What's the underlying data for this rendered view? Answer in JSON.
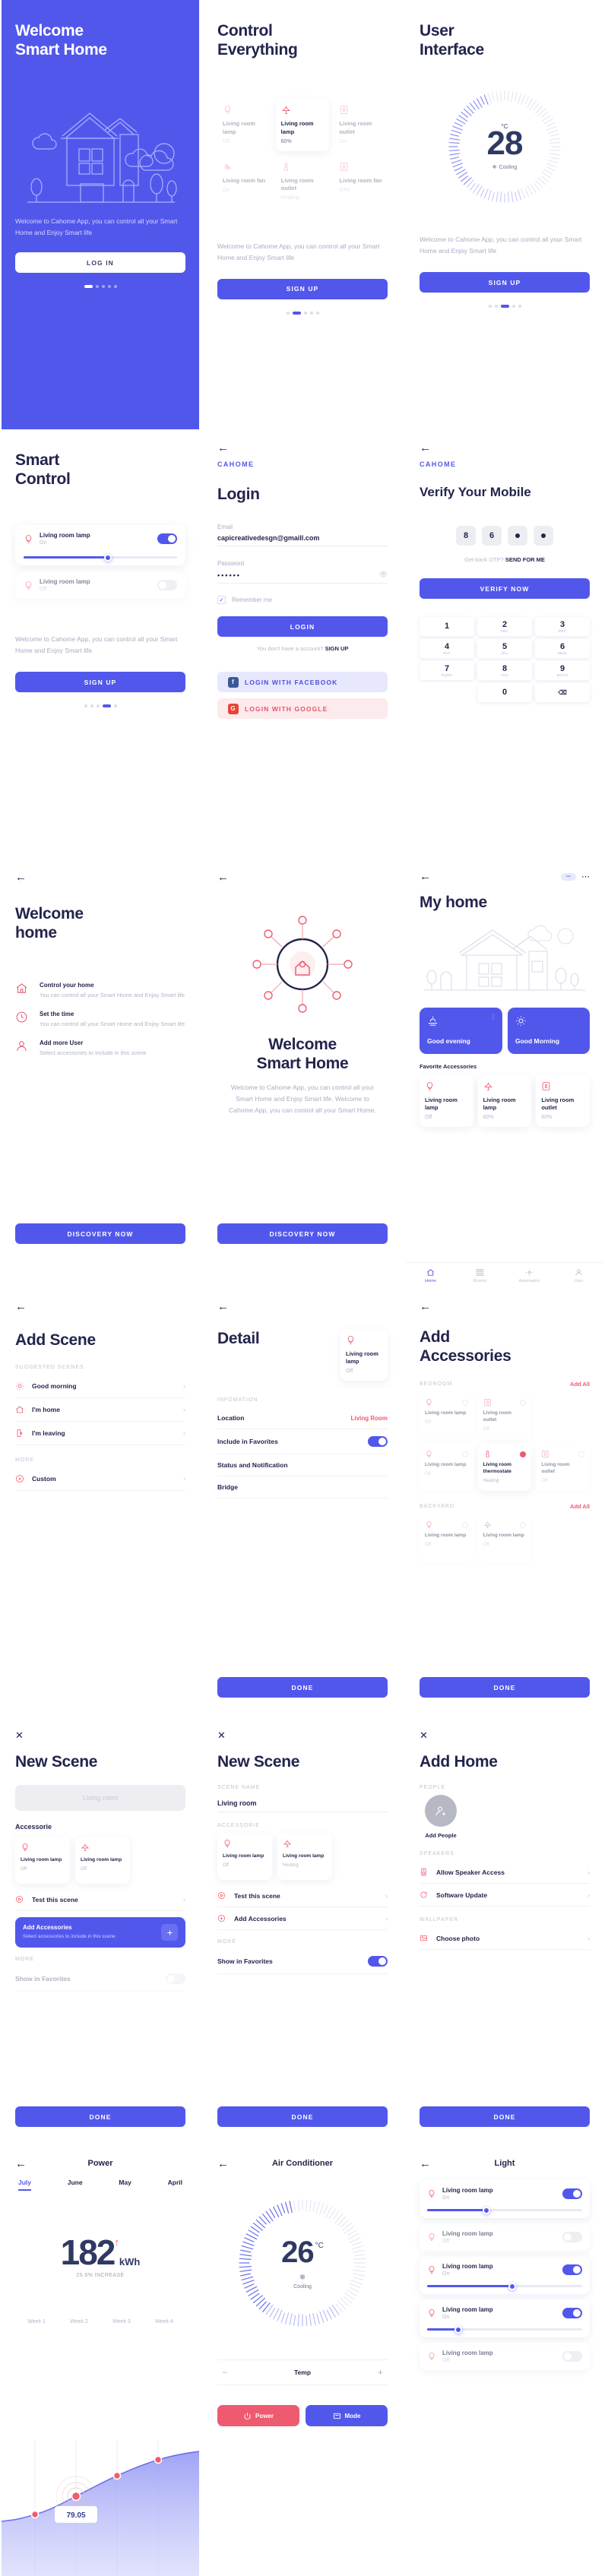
{
  "brand": "CAHOME",
  "tagline": "Welcome to Cahome App, you can control all your Smart Home and Enjoy Smart life",
  "colors": {
    "primary": "#5257ec",
    "accent": "#ee5b70",
    "dark": "#23244d",
    "muted": "#b1b3c7"
  },
  "screens": {
    "welcome": {
      "title_line1": "Welcome",
      "title_line2": "Smart Home",
      "caption": "Welcome to Cahome App, you can control all your Smart Home and Enjoy Smart life",
      "cta": "LOG IN",
      "dots": 5,
      "active": 0
    },
    "control": {
      "title_line1": "Control",
      "title_line2": "Everything",
      "caption": "Welcome to Cahome App, you can control all your Smart Home and Enjoy Smart life",
      "cta": "SIGN UP",
      "dots": 5,
      "active": 1,
      "devices": [
        {
          "icon": "bulb-icon",
          "name": "Living room lamp",
          "status": "Off",
          "state": "dim"
        },
        {
          "icon": "lamp-icon",
          "name": "Living room lamp",
          "status": "60%",
          "state": "active"
        },
        {
          "icon": "outlet-icon",
          "name": "Living room outlet",
          "status": "On",
          "state": "dim"
        },
        {
          "icon": "fan-icon",
          "name": "Living room fan",
          "status": "On",
          "state": "dim"
        },
        {
          "icon": "thermostat-icon",
          "name": "Living room outlet",
          "status": "Heating",
          "state": "dim"
        },
        {
          "icon": "outlet-icon",
          "name": "Living room fan",
          "status": "60%",
          "state": "dim"
        }
      ]
    },
    "user_interface": {
      "title_line1": "User",
      "title_line2": "Interface",
      "caption": "Welcome to Cahome App, you can control all your Smart Home and Enjoy Smart life",
      "cta": "SIGN UP",
      "dots": 5,
      "active": 2,
      "unit": "°C",
      "value": "28",
      "mode": "Cooling"
    },
    "smart_control": {
      "title_line1": "Smart",
      "title_line2": "Control",
      "caption": "Welcome to Cahome App, you can control all your Smart Home and Enjoy Smart life",
      "cta": "SIGN UP",
      "dots": 5,
      "active": 3,
      "items": [
        {
          "name": "Living room lamp",
          "status": "On",
          "toggle": "on",
          "slider": 55
        },
        {
          "name": "Living room lamp",
          "status": "Off",
          "toggle": "off",
          "slider": 0
        }
      ]
    },
    "login": {
      "brand": "CAHOME",
      "title": "Login",
      "email_label": "Email",
      "email_value": "capicreativedesgn@gmaill.com",
      "password_label": "Password",
      "password_value": "••••••",
      "remember": "Remember me",
      "cta": "LOGIN",
      "signup_prompt": "You don't have a account?",
      "signup_link": "SIGN UP",
      "facebook": "LOGIN WITH FACEBOOK",
      "google": "LOGIN WITH GOOGLE"
    },
    "verify": {
      "brand": "CAHOME",
      "title": "Verify Your Mobile",
      "otp": [
        "8",
        "6",
        "•",
        "•"
      ],
      "resend_prompt": "Get back OTP?",
      "resend_link": "SEND FOR ME",
      "cta": "VERIFY NOW",
      "keys": [
        {
          "n": "1",
          "s": ""
        },
        {
          "n": "2",
          "s": "ABC"
        },
        {
          "n": "3",
          "s": "DEF"
        },
        {
          "n": "4",
          "s": "GHI"
        },
        {
          "n": "5",
          "s": "JKL"
        },
        {
          "n": "6",
          "s": "MNO"
        },
        {
          "n": "7",
          "s": "PQRS"
        },
        {
          "n": "8",
          "s": "TUV"
        },
        {
          "n": "9",
          "s": "WXYZ"
        }
      ],
      "zero": "0",
      "backspace": "⌫"
    },
    "welcome_home": {
      "title_line1": "Welcome",
      "title_line2": "home",
      "features": [
        {
          "icon": "home-icon",
          "title": "Control your home",
          "desc": "You can control all your Smart Home and Enjoy Smart life"
        },
        {
          "icon": "clock-icon",
          "title": "Set the time",
          "desc": "You can control all your Smart Home and Enjoy Smart life"
        },
        {
          "icon": "user-icon",
          "title": "Add more User",
          "desc": "Select accessories to include in this scene"
        }
      ],
      "cta": "DISCOVERY NOW"
    },
    "welcome_smart": {
      "title_line1": "Welcome",
      "title_line2": "Smart Home",
      "caption": "Welcome to Cahome App, you can control all your Smart Home and Enjoy Smart life. Welcome to Cahome App, you can control all your Smart Home.",
      "cta": "DISCOVERY NOW"
    },
    "my_home": {
      "title": "My home",
      "scenes": [
        {
          "icon": "sunset-icon",
          "name": "Good evening"
        },
        {
          "icon": "sun-icon",
          "name": "Good Morning"
        }
      ],
      "fav_label": "Favorite Accessories",
      "accessories": [
        {
          "icon": "bulb-icon",
          "name": "Living room lamp",
          "status": "Off"
        },
        {
          "icon": "lamp-icon",
          "name": "Living room lamp",
          "status": "60%"
        },
        {
          "icon": "outlet-icon",
          "name": "Living room outlet",
          "status": "60%"
        }
      ],
      "nav": [
        {
          "icon": "home-icon",
          "label": "Home",
          "active": true
        },
        {
          "icon": "rooms-icon",
          "label": "Rooms",
          "active": false
        },
        {
          "icon": "automation-icon",
          "label": "Automation",
          "active": false
        },
        {
          "icon": "user-icon",
          "label": "User",
          "active": false
        }
      ]
    },
    "add_scene": {
      "title": "Add Scene",
      "section_suggested": "SUGGESTED SCENES",
      "suggested": [
        {
          "icon": "sun-icon",
          "label": "Good morning"
        },
        {
          "icon": "home-icon",
          "label": "I'm home"
        },
        {
          "icon": "door-icon",
          "label": "I'm leaving"
        }
      ],
      "section_more": "MORE",
      "more": [
        {
          "icon": "plus-icon",
          "label": "Custom"
        }
      ]
    },
    "detail": {
      "title": "Detail",
      "card": {
        "icon": "bulb-icon",
        "name": "Living room lamp",
        "status": "Off"
      },
      "section": "INFOMATION",
      "rows": [
        {
          "label": "Location",
          "value": "Living Room",
          "type": "value"
        },
        {
          "label": "Include in Favorites",
          "value": "on",
          "type": "toggle"
        },
        {
          "label": "Status and Notification",
          "value": "",
          "type": "plain"
        },
        {
          "label": "Bridge",
          "value": "",
          "type": "plain"
        }
      ],
      "cta": "DONE"
    },
    "add_accessories": {
      "title_line1": "Add",
      "title_line2": "Accessories",
      "groups": [
        {
          "name": "BEDROOM",
          "add_all": "Add All",
          "items": [
            {
              "icon": "bulb-icon",
              "name": "Living room lamp",
              "status": "Off",
              "checked": false
            },
            {
              "icon": "outlet-icon",
              "name": "Living room outlet",
              "status": "Off",
              "checked": false
            },
            {
              "icon": "bulb-icon",
              "name": "Living room lamp",
              "status": "Off",
              "checked": false
            },
            {
              "icon": "thermostat-icon",
              "name": "Living room thermostate",
              "status": "Heating",
              "checked": true
            },
            {
              "icon": "outlet-icon",
              "name": "Living room outlet",
              "status": "Off",
              "checked": false
            }
          ]
        },
        {
          "name": "BACKYARD",
          "add_all": "Add All",
          "items": [
            {
              "icon": "bulb-icon",
              "name": "Living room lamp",
              "status": "Off",
              "checked": false
            },
            {
              "icon": "lamp-icon",
              "name": "Living room lamp",
              "status": "Off",
              "checked": false
            }
          ]
        }
      ],
      "cta": "DONE"
    },
    "new_scene_1": {
      "title": "New Scene",
      "placeholder": "Living room",
      "section_accessorie": "Accessorie",
      "accessories": [
        {
          "icon": "bulb-icon",
          "name": "Living room lamp",
          "status": "Off"
        },
        {
          "icon": "lamp-icon",
          "name": "Living room lamp",
          "status": "Off"
        }
      ],
      "test": "Test this scene",
      "tip_title": "Add Accessories",
      "tip_desc": "Select accessories to include in this scene",
      "section_more": "MORE",
      "more_row": "Show in Favorites",
      "cta": "DONE"
    },
    "new_scene_2": {
      "title": "New Scene",
      "scene_name_label": "SCENE NAME",
      "scene_name_value": "Living room",
      "section_accessorie": "ACCESSORIE",
      "accessories": [
        {
          "icon": "bulb-icon",
          "name": "Living room lamp",
          "status": "Off"
        },
        {
          "icon": "lamp-icon",
          "name": "Living room lamp",
          "status": "Heating"
        }
      ],
      "test": "Test this scene",
      "add": "Add Accessories",
      "section_more": "MORE",
      "more_row": "Show in Favorites",
      "more_toggle": "on",
      "cta": "DONE"
    },
    "add_home": {
      "title": "Add Home",
      "people_label": "PEOPLE",
      "add_people": "Add People",
      "speakers_label": "SPEAKERS",
      "speakers_row": "Allow Speaker Access",
      "software_row": "Software Update",
      "wallpaper_label": "WALLPAPER",
      "wallpaper_row": "Choose photo",
      "cta": "DONE"
    },
    "power": {
      "title": "Power",
      "tabs": [
        "July",
        "June",
        "May",
        "April"
      ],
      "active_tab": "July",
      "value": "182",
      "unit": "kWh",
      "change": "25.6% INCREASE",
      "tooltip": "79.05"
    },
    "air_conditioner": {
      "title": "Air Conditioner",
      "value": "26",
      "unit": "°C",
      "mode": "Cooling",
      "temp_label": "Temp",
      "minus": "−",
      "plus": "+",
      "buttons": [
        {
          "icon": "power-icon",
          "label": "Power",
          "style": "pink"
        },
        {
          "icon": "mode-icon",
          "label": "Mode",
          "style": "blue"
        }
      ]
    },
    "light": {
      "title": "Light",
      "lamps": [
        {
          "name": "Living room lamp",
          "status": "On",
          "toggle": "on",
          "slider": 38
        },
        {
          "name": "Living room lamp",
          "status": "Off",
          "toggle": "off",
          "slider": 0
        },
        {
          "name": "Living room lamp",
          "status": "On",
          "toggle": "on",
          "slider": 55
        },
        {
          "name": "Living room lamp",
          "status": "On",
          "toggle": "on",
          "slider": 20
        },
        {
          "name": "Living room lamp",
          "status": "Off",
          "toggle": "off",
          "slider": 0
        }
      ]
    }
  },
  "chart_data": {
    "type": "area",
    "title": "Power",
    "categories": [
      "Week 1",
      "Week 2",
      "Week 3",
      "Week 4"
    ],
    "values": [
      62,
      79.05,
      108,
      142
    ],
    "highlight_index": 1,
    "highlight_label": "79.05",
    "ylabel": "kWh",
    "xlabel": "",
    "total": 182,
    "total_unit": "kWh",
    "change_pct": 25.6,
    "change_dir": "increase",
    "grid": true,
    "legend": "none"
  }
}
